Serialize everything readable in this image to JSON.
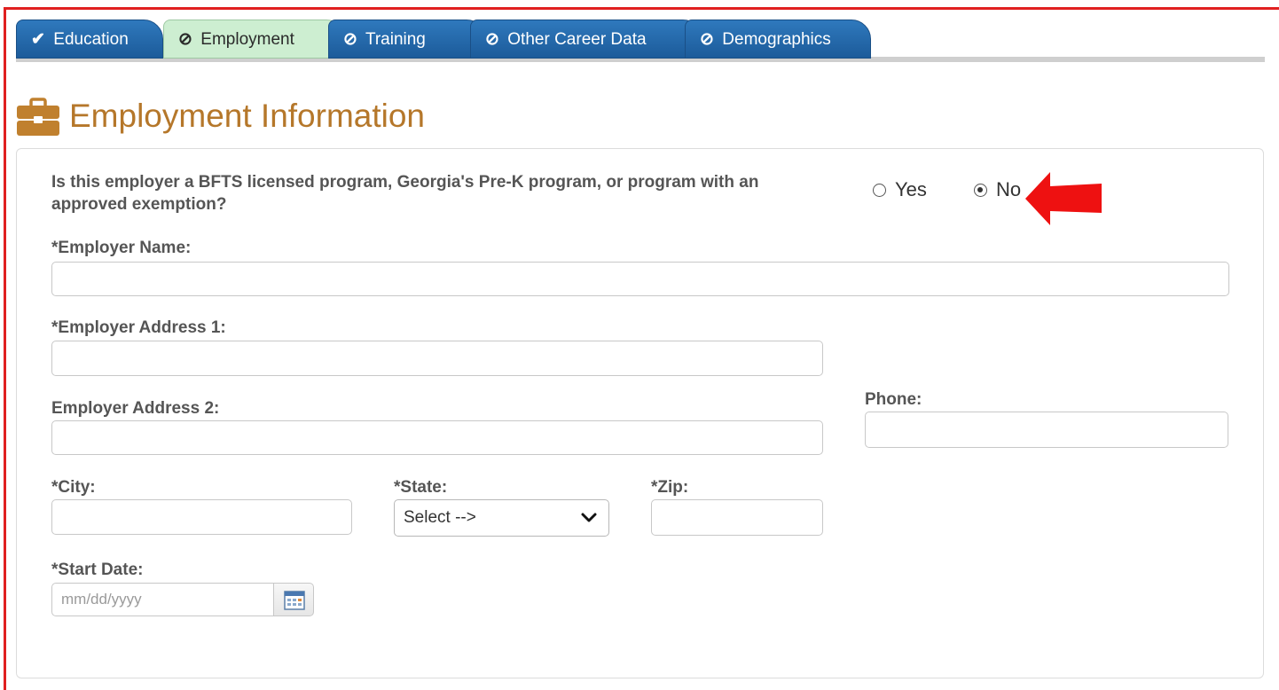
{
  "tabs": [
    {
      "label": "Education",
      "icon": "check-icon",
      "state": "complete"
    },
    {
      "label": "Employment",
      "icon": "no-symbol-icon",
      "state": "active"
    },
    {
      "label": "Training",
      "icon": "no-symbol-icon",
      "state": "incomplete"
    },
    {
      "label": "Other Career Data",
      "icon": "no-symbol-icon",
      "state": "incomplete"
    },
    {
      "label": "Demographics",
      "icon": "no-symbol-icon",
      "state": "incomplete"
    }
  ],
  "icons": {
    "check": "✔",
    "no_symbol": "⊘"
  },
  "page": {
    "title": "Employment Information",
    "title_icon": "briefcase-icon",
    "title_color": "#b5772a"
  },
  "form": {
    "question": "Is this employer a BFTS licensed program, Georgia's Pre-K program, or program with an approved exemption?",
    "radio_options": [
      {
        "label": "Yes",
        "selected": false
      },
      {
        "label": "No",
        "selected": true
      }
    ],
    "employer_name": {
      "label": "*Employer Name:",
      "value": ""
    },
    "address1": {
      "label": "*Employer Address 1:",
      "value": ""
    },
    "address2": {
      "label": "Employer Address 2:",
      "value": ""
    },
    "phone": {
      "label": "Phone:",
      "value": ""
    },
    "city": {
      "label": "*City:",
      "value": ""
    },
    "state": {
      "label": "*State:",
      "selected": "Select -->"
    },
    "zip": {
      "label": "*Zip:",
      "value": ""
    },
    "start_date": {
      "label": "*Start Date:",
      "value": "",
      "placeholder": "mm/dd/yyyy"
    }
  },
  "annotation": {
    "arrow_icon": "red-arrow-icon",
    "arrow_color": "#ee1111"
  },
  "colors": {
    "tab_blue": "#2f79bd",
    "tab_active": "#cdeed1",
    "frame_red": "#e02020"
  }
}
